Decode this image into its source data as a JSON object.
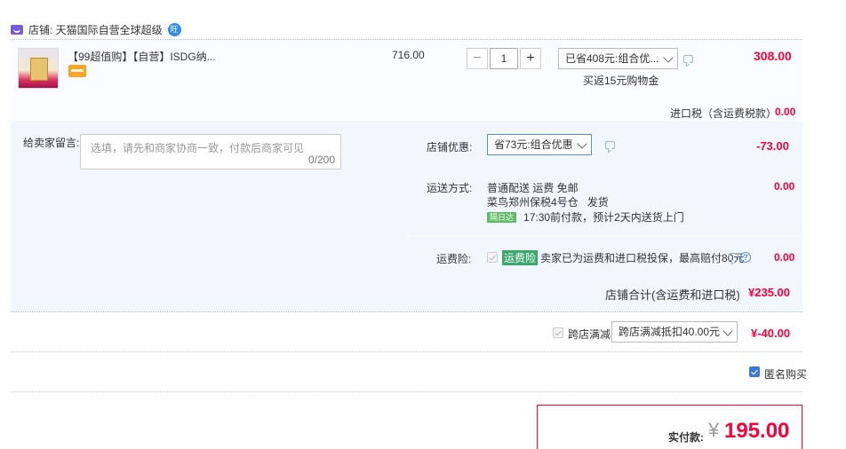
{
  "store": {
    "name": "店铺: 天猫国际自营全球超级",
    "wang": "旺"
  },
  "item": {
    "title": "【99超值购】【自营】ISDG纳...",
    "unit_price": "716.00",
    "qty": {
      "minus": "−",
      "value": "1",
      "plus": "+"
    },
    "promo_select": "已省408元:组合优...",
    "cashback": "买返15元购物金",
    "subtotal": "308.00"
  },
  "tax": {
    "label": "进口税（含运费税款）",
    "value": "0.00"
  },
  "message": {
    "label": "给卖家留言:",
    "placeholder": "选填，请先和商家协商一致，付款后商家可见",
    "counter": "0/200"
  },
  "store_discount": {
    "label": "店铺优惠:",
    "select": "省73元:组合优惠",
    "value": "-73.00"
  },
  "shipping": {
    "label": "运送方式:",
    "line1": "普通配送 运费 免邮",
    "line2": "菜鸟郑州保税4号仓",
    "ship_word": "发货",
    "badge": "隔日达",
    "line3": "17:30前付款，预计2天内送货上门",
    "value": "0.00"
  },
  "insurance": {
    "label": "运费险:",
    "tag": "运费险",
    "text": "卖家已为运费和进口税投保，最高赔付80元",
    "help": "?",
    "value": "0.00"
  },
  "store_total": {
    "label": "店铺合计(含运费和进口税)",
    "value": "¥235.00"
  },
  "cross_store": {
    "label": "跨店满减",
    "select": "跨店满减抵扣40.00元",
    "value": "¥-40.00"
  },
  "anonymous": {
    "label": "匿名购买"
  },
  "payment": {
    "label": "实付款:",
    "currency": "¥",
    "value": "195.00"
  },
  "colors": {
    "accent": "#ff0036",
    "blue": "#3c78dc",
    "panel": "#f2f7ff"
  }
}
